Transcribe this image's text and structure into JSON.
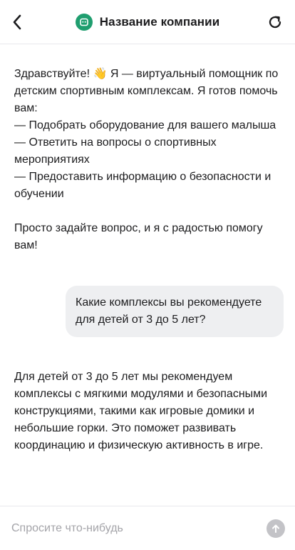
{
  "header": {
    "title": "Название компании",
    "back_icon": "chevron-left-icon",
    "refresh_icon": "refresh-icon",
    "logo_icon": "bot-logo-icon",
    "brand_color": "#1f9e6f"
  },
  "messages": [
    {
      "role": "assistant",
      "text": "Здравствуйте! 👋 Я — виртуальный помощник по детским спортивным комплексам. Я готов помочь вам:\n— Подобрать оборудование для вашего малыша\n— Ответить на вопросы о спортивных мероприятиях\n— Предоставить информацию о безопасности и обучении\n\nПросто задайте вопрос, и я с радостью помогу вам!"
    },
    {
      "role": "user",
      "text": "Какие комплексы вы рекомендуете для детей от 3 до 5 лет?"
    },
    {
      "role": "assistant",
      "text": "Для детей от 3 до 5 лет мы рекомендуем комплексы с мягкими модулями и безопасными конструкциями, такими как игровые домики и небольшие горки. Это поможет развивать координацию и физическую активность в игре."
    }
  ],
  "composer": {
    "placeholder": "Спросите что-нибудь",
    "value": "",
    "send_icon": "arrow-up-icon"
  }
}
